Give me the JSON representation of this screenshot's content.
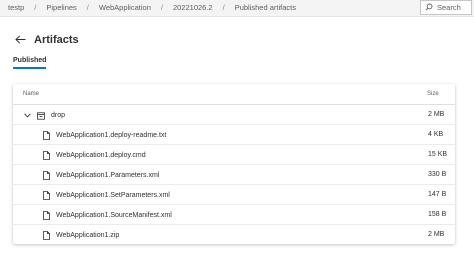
{
  "breadcrumb": {
    "items": [
      "testp",
      "Pipelines",
      "WebApplication",
      "20221026.2",
      "Published artifacts"
    ],
    "separator": "/"
  },
  "search": {
    "placeholder": "Search"
  },
  "header": {
    "title": "Artifacts",
    "back_icon": "arrow-left-icon"
  },
  "tabs": [
    {
      "label": "Published",
      "selected": true
    }
  ],
  "table": {
    "columns": {
      "name": "Name",
      "size": "Size"
    },
    "folder": {
      "name": "drop",
      "size": "2 MB",
      "expanded": true
    },
    "files": [
      {
        "name": "WebApplication1.deploy-readme.txt",
        "size": "4 KB"
      },
      {
        "name": "WebApplication1.deploy.cmd",
        "size": "15 KB"
      },
      {
        "name": "WebApplication1.Parameters.xml",
        "size": "330 B"
      },
      {
        "name": "WebApplication1.SetParameters.xml",
        "size": "147 B"
      },
      {
        "name": "WebApplication1.SourceManifest.xml",
        "size": "158 B"
      },
      {
        "name": "WebApplication1.zip",
        "size": "2 MB"
      }
    ]
  },
  "colors": {
    "accent": "#0078d4",
    "text": "#323130",
    "muted": "#605e5c"
  }
}
